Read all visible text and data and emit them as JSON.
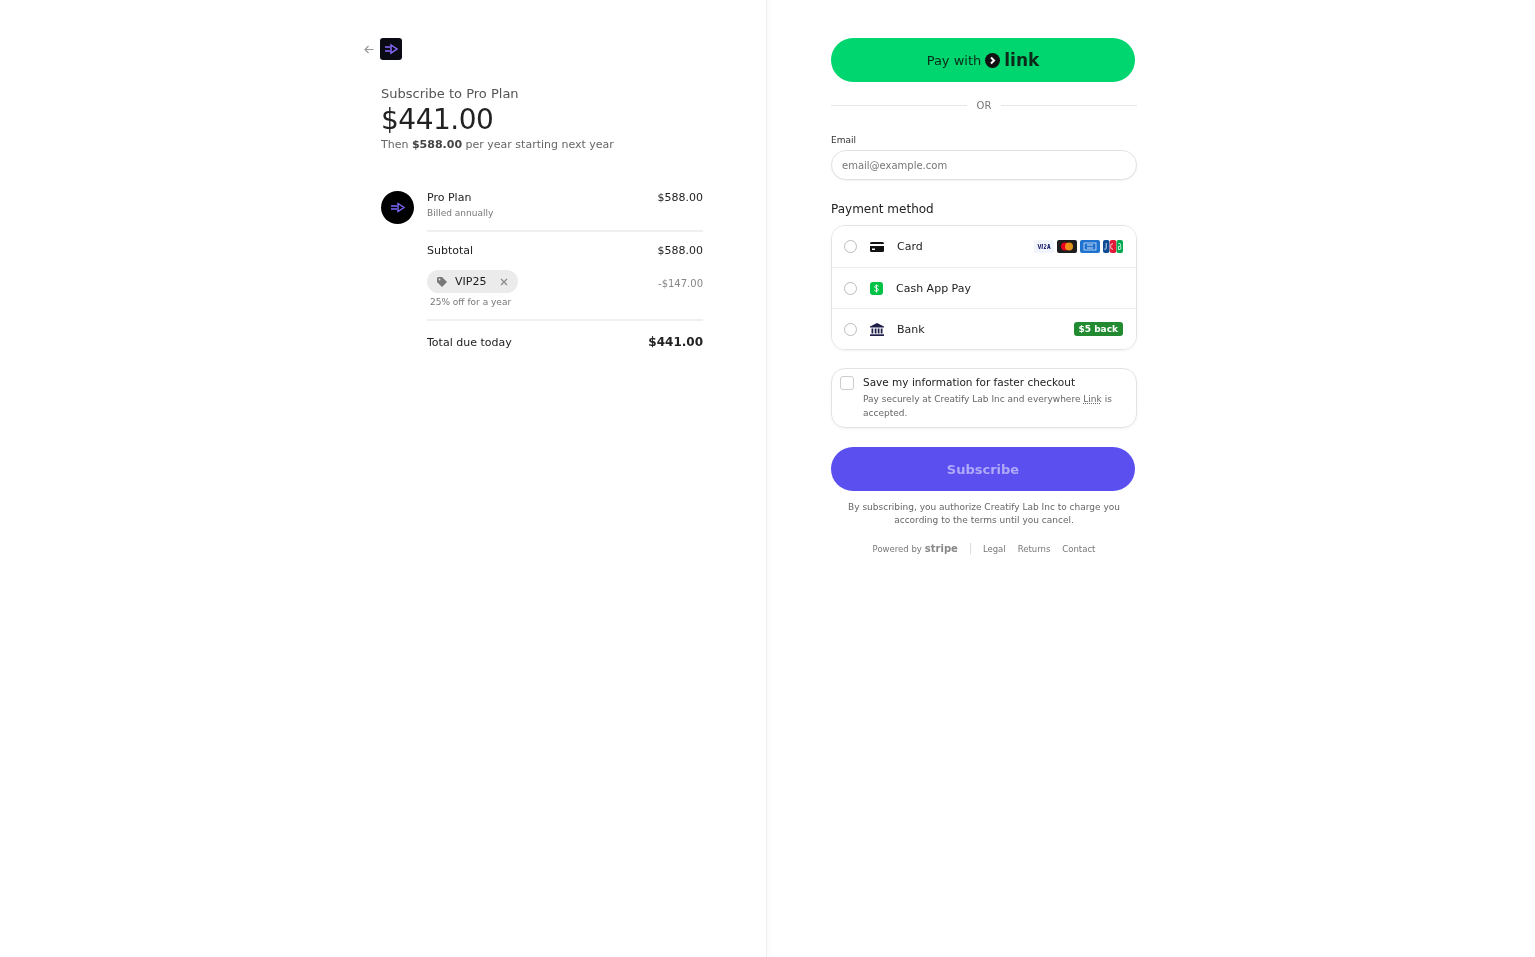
{
  "summary": {
    "title": "Subscribe to Pro Plan",
    "amount": "$441.00",
    "then_text": "Then **$588.00** per year starting next year",
    "line_items": [
      {
        "name": "Pro Plan",
        "note": "Billed annually",
        "price": "$588.00"
      }
    ],
    "subtotal": {
      "label": "Subtotal",
      "value": "$588.00"
    },
    "promo": {
      "code": "VIP25",
      "note": "25% off for a year",
      "value": "-$147.00"
    },
    "total": {
      "label": "Total due today",
      "value": "$441.00"
    }
  },
  "checkout": {
    "link_button": {
      "prefix": "Pay with",
      "brand": "link"
    },
    "separator": "OR",
    "email": {
      "label": "Email",
      "placeholder": "email@example.com"
    },
    "payment_heading": "Payment method",
    "methods": [
      {
        "kind": "card",
        "label": "Card",
        "selected": false
      },
      {
        "kind": "cashapp",
        "label": "Cash App Pay",
        "selected": false
      },
      {
        "kind": "bank",
        "label": "Bank",
        "selected": false,
        "badge": "$5 back"
      }
    ],
    "save_info": {
      "checked": false,
      "title": "Save my information for faster checkout",
      "text_before": "Pay securely at Creatify Lab Inc and everywhere",
      "link": "Link",
      "text_after": "is accepted."
    },
    "subscribe": {
      "label": "Subscribe",
      "disabled": true
    },
    "terms": "By subscribing, you authorize Creatify Lab Inc to charge you according to the terms until you cancel.",
    "footer": {
      "powered": "Powered by",
      "brand": "stripe",
      "links": [
        "Legal",
        "Returns",
        "Contact"
      ]
    }
  }
}
